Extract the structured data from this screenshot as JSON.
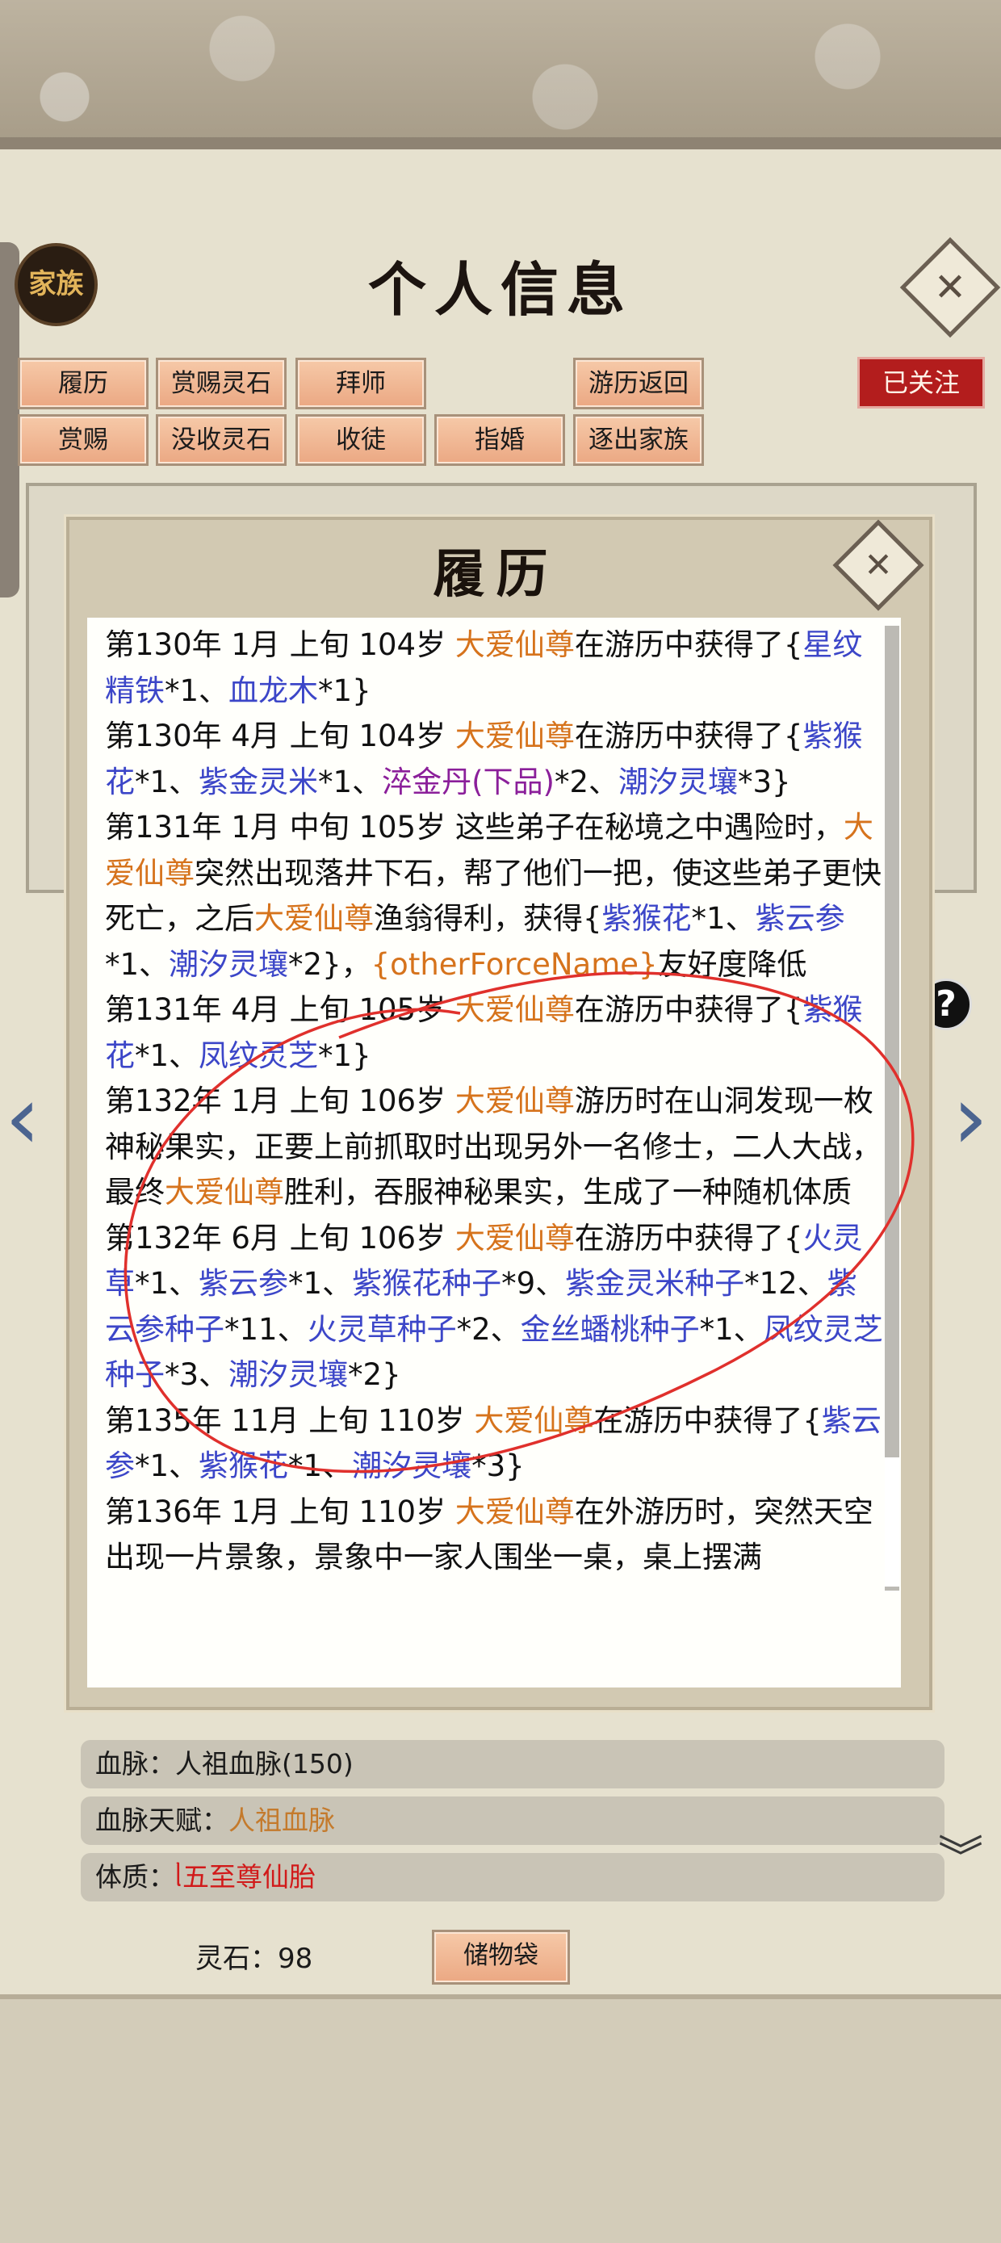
{
  "header": {
    "title": "个人信息",
    "family_label": "家族",
    "follow_label": "已关注"
  },
  "buttons_row1": [
    "履历",
    "赏赐灵石",
    "拜师",
    "游历返回"
  ],
  "buttons_row2": [
    "赏赐",
    "没收灵石",
    "收徒",
    "指婚",
    "逐出家族"
  ],
  "info_rows": {
    "bloodline_label": "血脉：",
    "bloodline_value": "人祖血脉(150)",
    "talent_label": "血脉天赋：",
    "talent_value": "人祖血脉",
    "physique_label": "体质：",
    "physique_value": "ᥣ五至尊仙胎"
  },
  "footer": {
    "spirit_stone": "灵石：98",
    "bag_button": "储物袋"
  },
  "modal": {
    "title": "履历",
    "entries": [
      [
        {
          "t": "第130年 1月 上旬 104岁 "
        },
        {
          "t": "大爱仙尊",
          "c": "or"
        },
        {
          "t": "在游历中获得了{"
        },
        {
          "t": "星纹精铁",
          "c": "bl"
        },
        {
          "t": "*1、"
        },
        {
          "t": "血龙木",
          "c": "bl"
        },
        {
          "t": "*1}"
        }
      ],
      [
        {
          "t": "第130年 4月 上旬 104岁 "
        },
        {
          "t": "大爱仙尊",
          "c": "or"
        },
        {
          "t": "在游历中获得了{"
        },
        {
          "t": "紫猴花",
          "c": "bl"
        },
        {
          "t": "*1、"
        },
        {
          "t": "紫金灵米",
          "c": "bl"
        },
        {
          "t": "*1、"
        },
        {
          "t": "淬金丹(下品)",
          "c": "pu"
        },
        {
          "t": "*2、"
        },
        {
          "t": "潮汐灵壤",
          "c": "bl"
        },
        {
          "t": "*3}"
        }
      ],
      [
        {
          "t": "第131年 1月 中旬 105岁 这些弟子在秘境之中遇险时，"
        },
        {
          "t": "大爱仙尊",
          "c": "or"
        },
        {
          "t": "突然出现落井下石，帮了他们一把，使这些弟子更快死亡，之后"
        },
        {
          "t": "大爱仙尊",
          "c": "or"
        },
        {
          "t": "渔翁得利，获得{"
        },
        {
          "t": "紫猴花",
          "c": "bl"
        },
        {
          "t": "*1、"
        },
        {
          "t": "紫云参",
          "c": "bl"
        },
        {
          "t": "*1、"
        },
        {
          "t": "潮汐灵壤",
          "c": "bl"
        },
        {
          "t": "*2}，"
        },
        {
          "t": "{otherForceName}",
          "c": "or"
        },
        {
          "t": "友好度降低"
        }
      ],
      [
        {
          "t": "第131年 4月 上旬 105岁 "
        },
        {
          "t": "大爱仙尊",
          "c": "or"
        },
        {
          "t": "在游历中获得了{"
        },
        {
          "t": "紫猴花",
          "c": "bl"
        },
        {
          "t": "*1、"
        },
        {
          "t": "凤纹灵芝",
          "c": "bl"
        },
        {
          "t": "*1}"
        }
      ],
      [
        {
          "t": "第132年 1月 上旬 106岁 "
        },
        {
          "t": "大爱仙尊",
          "c": "or"
        },
        {
          "t": "游历时在山洞发现一枚神秘果实，正要上前抓取时出现另外一名修士，二人大战，最终"
        },
        {
          "t": "大爱仙尊",
          "c": "or"
        },
        {
          "t": "胜利，吞服神秘果实，生成了一种随机体质"
        }
      ],
      [
        {
          "t": "第132年 6月 上旬 106岁 "
        },
        {
          "t": "大爱仙尊",
          "c": "or"
        },
        {
          "t": "在游历中获得了{"
        },
        {
          "t": "火灵草",
          "c": "bl"
        },
        {
          "t": "*1、"
        },
        {
          "t": "紫云参",
          "c": "bl"
        },
        {
          "t": "*1、"
        },
        {
          "t": "紫猴花种子",
          "c": "bl"
        },
        {
          "t": "*9、"
        },
        {
          "t": "紫金灵米种子",
          "c": "bl"
        },
        {
          "t": "*12、"
        },
        {
          "t": "紫云参种子",
          "c": "bl"
        },
        {
          "t": "*11、"
        },
        {
          "t": "火灵草种子",
          "c": "bl"
        },
        {
          "t": "*2、"
        },
        {
          "t": "金丝蟠桃种子",
          "c": "bl"
        },
        {
          "t": "*1、"
        },
        {
          "t": "凤纹灵芝种子",
          "c": "bl"
        },
        {
          "t": "*3、"
        },
        {
          "t": "潮汐灵壤",
          "c": "bl"
        },
        {
          "t": "*2}"
        }
      ],
      [
        {
          "t": "第135年 11月 上旬 110岁 "
        },
        {
          "t": "大爱仙尊",
          "c": "or"
        },
        {
          "t": "在游历中获得了{"
        },
        {
          "t": "紫云参",
          "c": "bl"
        },
        {
          "t": "*1、"
        },
        {
          "t": "紫猴花",
          "c": "bl"
        },
        {
          "t": "*1、"
        },
        {
          "t": "潮汐灵壤",
          "c": "bl"
        },
        {
          "t": "*3}"
        }
      ],
      [
        {
          "t": "第136年 1月 上旬 110岁 "
        },
        {
          "t": "大爱仙尊",
          "c": "or"
        },
        {
          "t": "在外游历时，突然天空出现一片景象，景象中一家人围坐一桌，桌上摆满"
        }
      ]
    ]
  },
  "colors": {
    "accent_orange": "#d6731c",
    "item_blue": "#3c46c8",
    "item_purple": "#8b1f9a",
    "follow_red": "#b31d1d"
  }
}
